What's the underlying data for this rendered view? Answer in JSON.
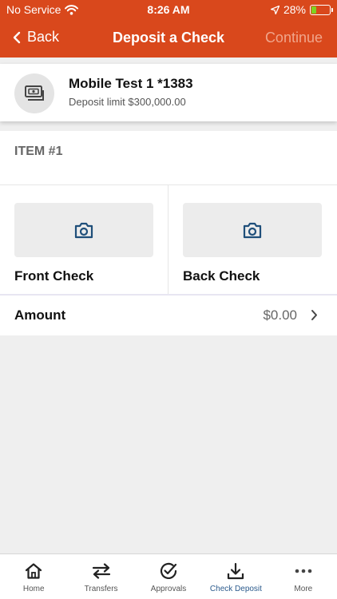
{
  "status_bar": {
    "carrier": "No Service",
    "time": "8:26 AM",
    "battery_percent": "28%",
    "battery_level": 0.28
  },
  "nav": {
    "back_label": "Back",
    "title": "Deposit a Check",
    "continue_label": "Continue"
  },
  "account": {
    "name": "Mobile Test 1 *1383",
    "limit": "Deposit limit $300,000.00"
  },
  "item": {
    "header": "ITEM #1",
    "front_label": "Front Check",
    "back_label": "Back Check"
  },
  "amount": {
    "label": "Amount",
    "value": "$0.00"
  },
  "tabs": [
    {
      "label": "Home",
      "icon": "home-icon"
    },
    {
      "label": "Transfers",
      "icon": "transfer-arrows-icon"
    },
    {
      "label": "Approvals",
      "icon": "check-circle-icon"
    },
    {
      "label": "Check Deposit",
      "icon": "download-icon"
    },
    {
      "label": "More",
      "icon": "more-dots-icon"
    }
  ],
  "colors": {
    "brand": "#d9481c",
    "continue_disabled": "#f0a58b",
    "active_tab": "#2b5a8c",
    "camera_icon": "#1f4f7a",
    "battery": "#7ed321"
  }
}
